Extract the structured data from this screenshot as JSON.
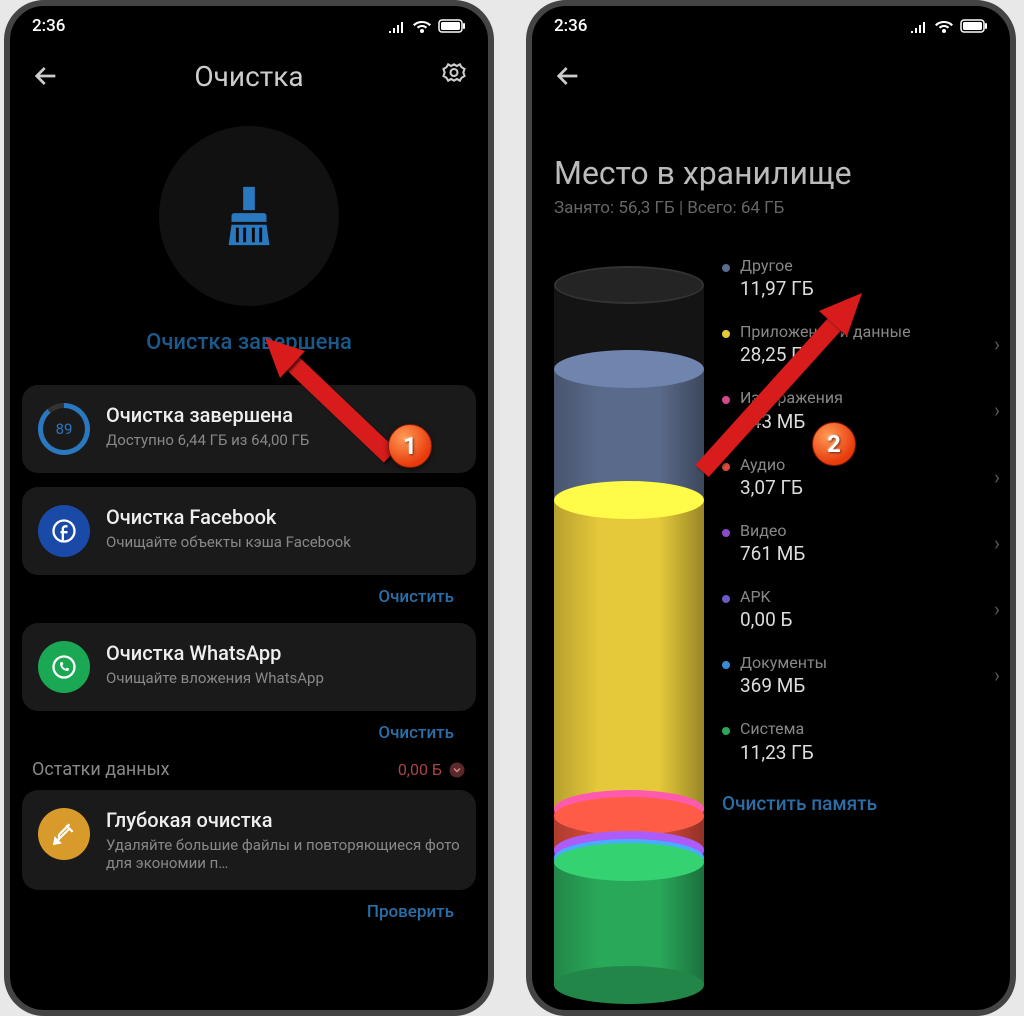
{
  "status_bar": {
    "time": "2:36"
  },
  "screen1": {
    "title": "Очистка",
    "status_text": "Очистка завершена",
    "progress_ring_value": "89",
    "cards": {
      "done": {
        "title": "Очистка завершена",
        "sub": "Доступно 6,44 ГБ из 64,00 ГБ"
      },
      "fb": {
        "title": "Очистка Facebook",
        "sub": "Очищайте объекты кэша Facebook",
        "btn": "Очистить"
      },
      "wa": {
        "title": "Очистка WhatsApp",
        "sub": "Очищайте вложения WhatsApp",
        "btn": "Очистить"
      },
      "deep": {
        "title": "Глубокая очистка",
        "sub": "Удаляйте большие файлы и повторяющиеся фото для экономии п…",
        "btn": "Проверить"
      }
    },
    "leftover": {
      "label": "Остатки данных",
      "value": "0,00 Б"
    }
  },
  "screen2": {
    "title": "Место в хранилище",
    "subtitle": "Занято: 56,3 ГБ | Всего: 64 ГБ",
    "clear_button": "Очистить память",
    "categories": [
      {
        "label": "Другое",
        "value": "11,97 ГБ",
        "color": "#5a6a8a",
        "chev": false
      },
      {
        "label": "Приложения и данные",
        "value": "28,25 ГБ",
        "color": "#e5c93a",
        "chev": true
      },
      {
        "label": "Изображения",
        "value": "643 МБ",
        "color": "#d5488a",
        "chev": true
      },
      {
        "label": "Аудио",
        "value": "3,07 ГБ",
        "color": "#d84a3a",
        "chev": true
      },
      {
        "label": "Видео",
        "value": "761 МБ",
        "color": "#8a4ac8",
        "chev": true
      },
      {
        "label": "APK",
        "value": "0,00 Б",
        "color": "#6a5ac8",
        "chev": true
      },
      {
        "label": "Документы",
        "value": "369 МБ",
        "color": "#3a8ad8",
        "chev": true
      },
      {
        "label": "Система",
        "value": "11,23 ГБ",
        "color": "#2aa85a",
        "chev": false
      }
    ]
  },
  "annotations": {
    "badge1": "1",
    "badge2": "2"
  },
  "chart_data": {
    "type": "bar",
    "title": "Место в хранилище",
    "ylabel": "ГБ",
    "ylim": [
      0,
      64
    ],
    "total_gb": 64,
    "used_gb": 56.3,
    "categories": [
      "Другое",
      "Приложения и данные",
      "Изображения",
      "Аудио",
      "Видео",
      "APK",
      "Документы",
      "Система"
    ],
    "values": [
      11.97,
      28.25,
      0.643,
      3.07,
      0.761,
      0.0,
      0.369,
      11.23
    ],
    "colors": [
      "#5a6a8a",
      "#e5c93a",
      "#d5488a",
      "#d84a3a",
      "#8a4ac8",
      "#6a5ac8",
      "#3a8ad8",
      "#2aa85a"
    ]
  }
}
